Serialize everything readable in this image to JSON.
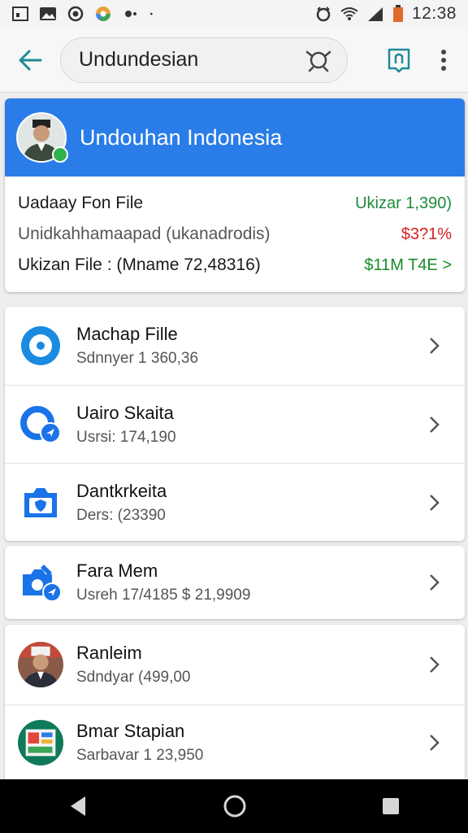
{
  "status_bar": {
    "time": "12:38",
    "icons": [
      "screenshot-icon",
      "image-icon",
      "record-icon",
      "chrome-icon",
      "dot-icon",
      "alarm-icon",
      "wifi-icon",
      "signal-icon",
      "battery-icon"
    ]
  },
  "toolbar": {
    "back_icon": "arrow-left-icon",
    "search_text": "Undundesian",
    "search_icon": "search-icon",
    "bookmark_icon": "bookmark-icon",
    "more_icon": "more-vert-icon"
  },
  "profile": {
    "title": "Undouhan Indonesia",
    "rows": [
      {
        "label": "Uadaay Fon File",
        "value": "Ukizar 1,390)"
      },
      {
        "label": "Unidkahhamaapad (ukanadrodis)",
        "value": "$3?1%"
      },
      {
        "label": "Ukizan File : (Mname 72,48316)",
        "value": "$11M T4E >"
      }
    ]
  },
  "colors": {
    "accent": "#2a7de8",
    "icon_blue": "#1a73e8",
    "positive": "#1e8b3a",
    "negative": "#d62020"
  },
  "group1": [
    {
      "title": "Machap Fille",
      "subtitle": "Sdnnyer 1 360,36",
      "icon": "circle-target-icon"
    },
    {
      "title": "Uairo Skaita",
      "subtitle": "Usrsi: 174,190",
      "icon": "location-badge-icon"
    },
    {
      "title": "Dantkrkeita",
      "subtitle": "Ders: (23390",
      "icon": "camera-shield-icon"
    }
  ],
  "group2": [
    {
      "title": "Fara Mem",
      "subtitle": "Usreh 17/4185 $ 21,9909",
      "icon": "camera-edit-icon"
    }
  ],
  "group3": [
    {
      "title": "Ranleim",
      "subtitle": "Sdndyar (499,00",
      "icon": "person-avatar"
    },
    {
      "title": "Bmar Stapian",
      "subtitle": "Sarbavar 1 23,950",
      "icon": "store-avatar"
    }
  ],
  "navbar": {
    "back_icon": "nav-back-icon",
    "home_icon": "nav-home-icon",
    "recents_icon": "nav-recents-icon"
  }
}
